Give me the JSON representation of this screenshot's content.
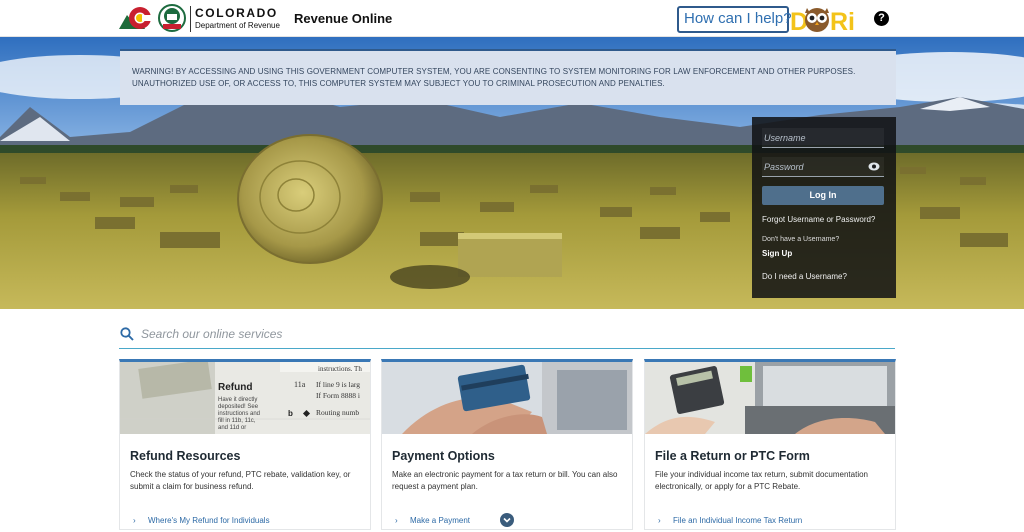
{
  "header": {
    "logo_line1": "COLORADO",
    "logo_line2": "Department of Revenue",
    "app_title": "Revenue Online",
    "help_text": "How can I help?",
    "dori_text": "DORi",
    "help_icon": "question-circle-icon"
  },
  "warning": {
    "text": "WARNING! BY ACCESSING AND USING THIS GOVERNMENT COMPUTER SYSTEM, YOU ARE CONSENTING TO SYSTEM MONITORING FOR LAW ENFORCEMENT AND OTHER PURPOSES. UNAUTHORIZED USE OF, OR ACCESS TO, THIS COMPUTER SYSTEM MAY SUBJECT YOU TO CRIMINAL PROSECUTION AND PENALTIES."
  },
  "login": {
    "username_placeholder": "Username",
    "password_placeholder": "Password",
    "login_button": "Log In",
    "forgot_link": "Forgot Username or Password?",
    "no_username_text": "Don't have a Username?",
    "signup_link": "Sign Up",
    "need_username_link": "Do I need a Username?"
  },
  "search": {
    "placeholder": "Search our online services"
  },
  "cards": [
    {
      "title": "Refund Resources",
      "description": "Check the status of your refund, PTC rebate, validation key, or submit a claim for business refund.",
      "link": "Where's My Refund for Individuals",
      "image_text": {
        "heading": "Refund",
        "lines": [
          "Have it directly",
          "deposited! See",
          "instructions and",
          "fill in 11b, 11c,",
          "and 11d or"
        ],
        "form_line_a": "instructions. Th",
        "form_line_b": "If line 9 is larg",
        "form_line_c": "If Form 8888 i",
        "form_line_d": "Routing numb",
        "line_num": "11a",
        "bullet": "b"
      }
    },
    {
      "title": "Payment Options",
      "description": "Make an electronic payment for a tax return or bill. You can also request a payment plan.",
      "link": "Make a Payment"
    },
    {
      "title": "File a Return or PTC Form",
      "description": "File your individual income tax return, submit documentation electronically, or apply for a PTC Rebate.",
      "link": "File an Individual Income Tax Return"
    }
  ],
  "colors": {
    "accent_blue": "#3a78b5",
    "warning_bg": "#d9e1ee",
    "login_button": "#4f6f8c",
    "link": "#2d6aa6"
  }
}
